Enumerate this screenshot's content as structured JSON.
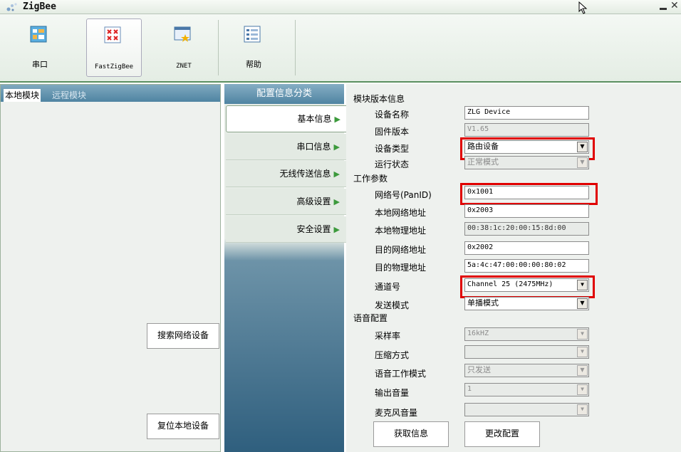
{
  "window": {
    "title": "ZigBee"
  },
  "toolbar": {
    "items": [
      {
        "label": "串口",
        "icon": "serial-port-icon"
      },
      {
        "label": "FastZigBee",
        "icon": "fastzigbee-icon"
      },
      {
        "label": "ZNET",
        "icon": "znet-icon"
      },
      {
        "label": "帮助",
        "icon": "help-icon"
      }
    ]
  },
  "left": {
    "tabs": [
      "本地模块",
      "远程模块"
    ],
    "search_button": "搜索网络设备",
    "reset_button": "复位本地设备"
  },
  "middle": {
    "header": "配置信息分类",
    "items": [
      "基本信息",
      "串口信息",
      "无线传送信息",
      "高级设置",
      "安全设置"
    ]
  },
  "right": {
    "sections": {
      "version": "模块版本信息",
      "work": "工作参数",
      "voice": "语音配置"
    },
    "fields": {
      "device_name": {
        "label": "设备名称",
        "value": "ZLG Device"
      },
      "firmware": {
        "label": "固件版本",
        "value": "V1.65"
      },
      "device_type": {
        "label": "设备类型",
        "value": "路由设备"
      },
      "run_state": {
        "label": "运行状态",
        "value": "正常模式"
      },
      "pan_id": {
        "label": "网络号(PanID)",
        "value": "0x1001"
      },
      "local_net_addr": {
        "label": "本地网络地址",
        "value": "0x2003"
      },
      "local_phys_addr": {
        "label": "本地物理地址",
        "value": "00:38:1c:20:00:15:8d:00"
      },
      "dest_net_addr": {
        "label": "目的网络地址",
        "value": "0x2002"
      },
      "dest_phys_addr": {
        "label": "目的物理地址",
        "value": "5a:4c:47:00:00:00:80:02"
      },
      "channel": {
        "label": "通道号",
        "value": "Channel 25 (2475MHz)"
      },
      "send_mode": {
        "label": "发送模式",
        "value": "单播模式"
      },
      "sample_rate": {
        "label": "采样率",
        "value": "16kHZ"
      },
      "compression": {
        "label": "压缩方式",
        "value": ""
      },
      "voice_mode": {
        "label": "语音工作模式",
        "value": "只发送"
      },
      "output_volume": {
        "label": "输出音量",
        "value": "1"
      },
      "mic_volume": {
        "label": "麦克风音量",
        "value": ""
      }
    },
    "get_button": "获取信息",
    "change_button": "更改配置"
  },
  "colors": {
    "accent_green": "#5a8f60",
    "panel_blue": "#4f84a2",
    "highlight_red": "#e00000"
  }
}
